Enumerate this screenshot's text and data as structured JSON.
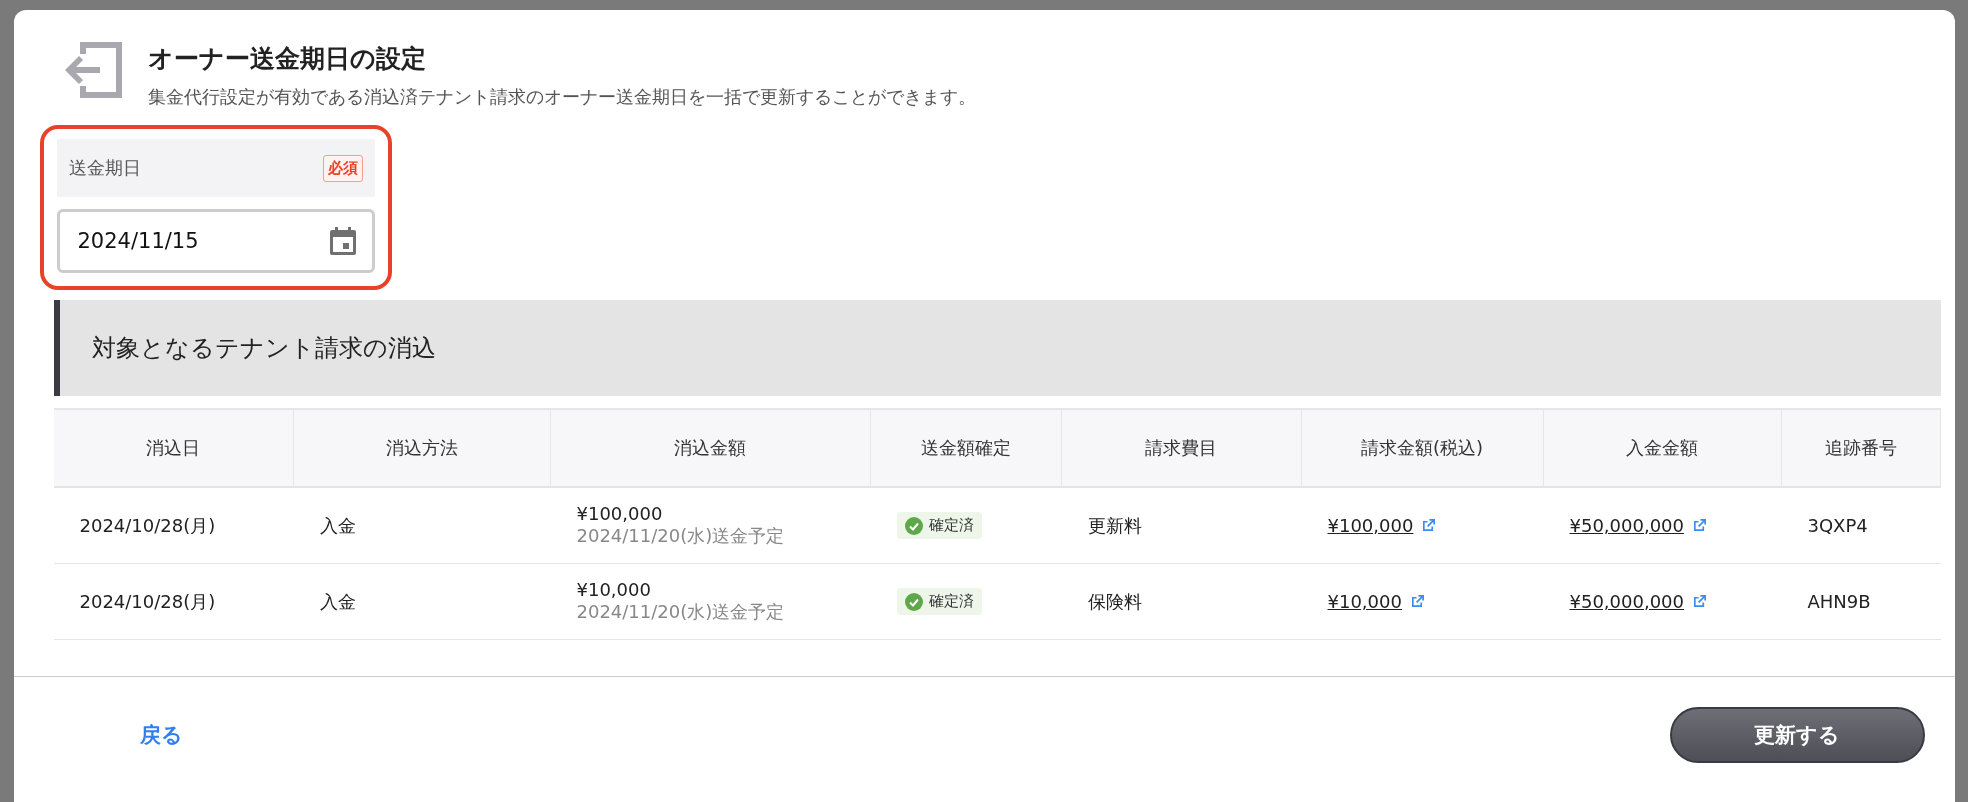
{
  "dialog": {
    "title": "オーナー送金期日の設定",
    "description": "集金代行設定が有効である消込済テナント請求のオーナー送金期日を一括で更新することができます。"
  },
  "field": {
    "label": "送金期日",
    "required_badge": "必須",
    "value": "2024/11/15",
    "highlighted": true
  },
  "section": {
    "title": "対象となるテナント請求の消込"
  },
  "table": {
    "columns": [
      "消込日",
      "消込方法",
      "消込金額",
      "送金額確定",
      "請求費目",
      "請求金額(税込)",
      "入金金額",
      "追跡番号"
    ],
    "rows": [
      {
        "date": "2024/10/28(月)",
        "method": "入金",
        "amount": "¥100,000",
        "schedule": "2024/11/20(水)送金予定",
        "status": "確定済",
        "confirmed": true,
        "item": "更新料",
        "billed": "¥100,000",
        "received": "¥50,000,000",
        "tracking": "3QXP4"
      },
      {
        "date": "2024/10/28(月)",
        "method": "入金",
        "amount": "¥10,000",
        "schedule": "2024/11/20(水)送金予定",
        "status": "確定済",
        "confirmed": true,
        "item": "保険料",
        "billed": "¥10,000",
        "received": "¥50,000,000",
        "tracking": "AHN9B"
      }
    ]
  },
  "footer": {
    "back": "戻る",
    "submit": "更新する"
  }
}
